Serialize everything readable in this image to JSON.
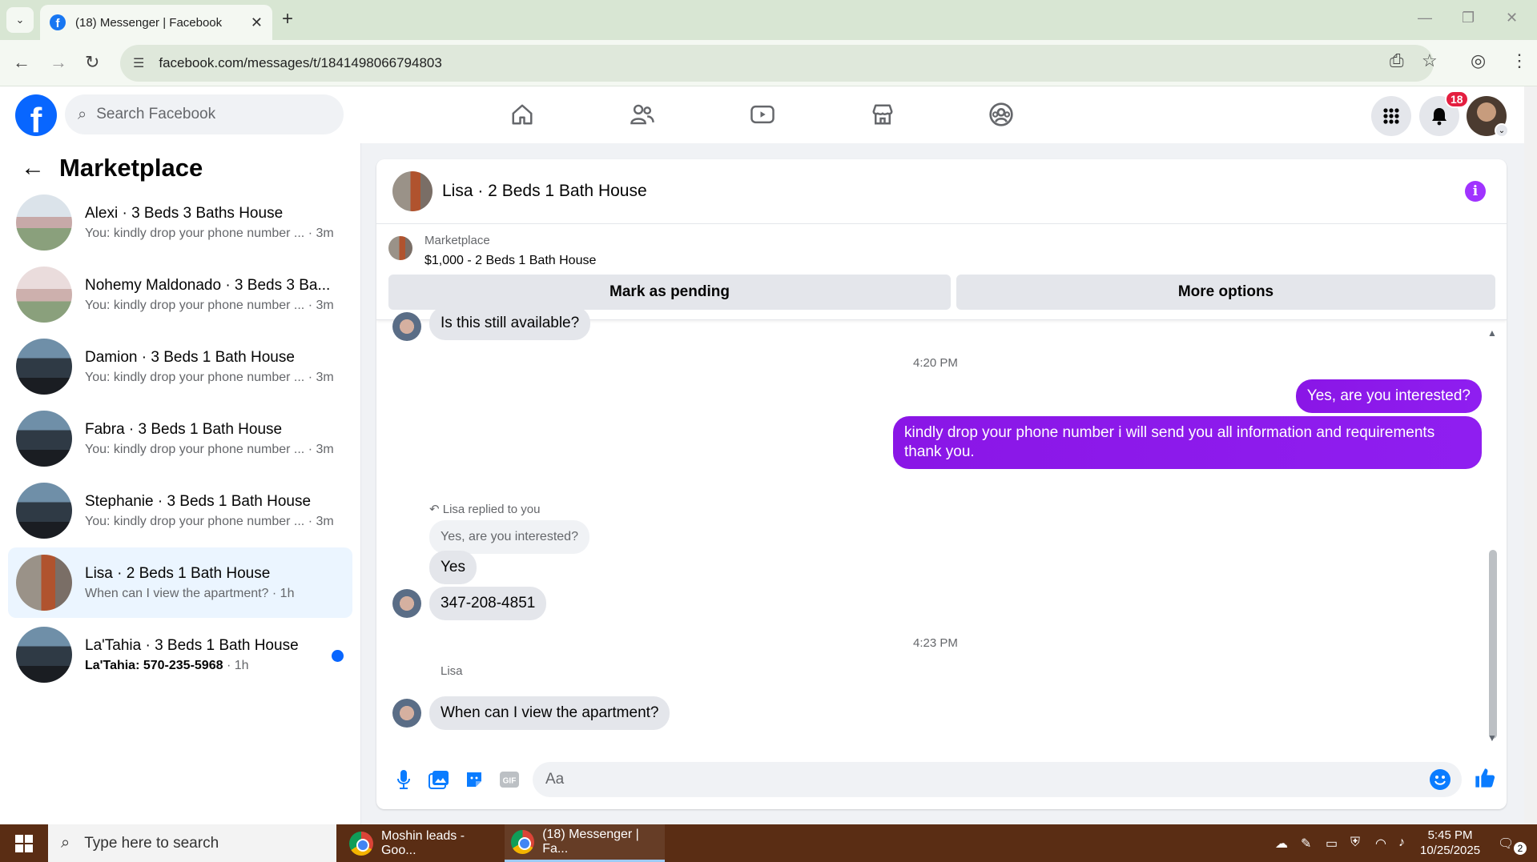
{
  "browser": {
    "tab_title": "(18) Messenger | Facebook",
    "url": "facebook.com/messages/t/1841498066794803"
  },
  "facebook": {
    "search_placeholder": "Search Facebook",
    "notification_count": "18"
  },
  "sidebar": {
    "title": "Marketplace",
    "conversations": [
      {
        "name": "Alexi · 3 Beds 3 Baths House",
        "preview": "You: kindly drop your phone number ... · 3m"
      },
      {
        "name": "Nohemy Maldonado · 3 Beds 3 Ba...",
        "preview": "You: kindly drop your phone number ... · 3m"
      },
      {
        "name": "Damion · 3 Beds 1 Bath House",
        "preview": "You: kindly drop your phone number ... · 3m"
      },
      {
        "name": "Fabra · 3 Beds 1 Bath House",
        "preview": "You: kindly drop your phone number ... · 3m"
      },
      {
        "name": "Stephanie · 3 Beds 1 Bath House",
        "preview": "You: kindly drop your phone number ... · 3m"
      },
      {
        "name": "Lisa · 2 Beds 1 Bath House",
        "preview": "When can I view the apartment? · 1h"
      },
      {
        "name": "La'Tahia · 3 Beds 1 Bath House",
        "preview": "La'Tahia: 570-235-5968",
        "preview_time": " · 1h"
      }
    ]
  },
  "chat": {
    "title": "Lisa · 2 Beds 1 Bath House",
    "marketplace_label": "Marketplace",
    "listing": "$1,000 - 2 Beds 1 Bath House",
    "mark_pending": "Mark as pending",
    "more_options": "More options",
    "messages": {
      "m1": "Is this still available?",
      "time1": "4:20 PM",
      "m2": "Yes, are you interested?",
      "m3": "kindly drop your phone number i will send you all information and requirements thank you.",
      "reply_note": "Lisa replied to you",
      "reply_quote": "Yes, are you interested?",
      "m4": "Yes",
      "m5": "347-208-4851",
      "time2": "4:23 PM",
      "sender": "Lisa",
      "m6": "When can I view the apartment?"
    },
    "composer_placeholder": "Aa"
  },
  "taskbar": {
    "search_placeholder": "Type here to search",
    "app1": "Moshin leads - Goo...",
    "app2": "(18) Messenger | Fa...",
    "time": "5:45 PM",
    "date": "10/25/2025",
    "notif": "2"
  }
}
